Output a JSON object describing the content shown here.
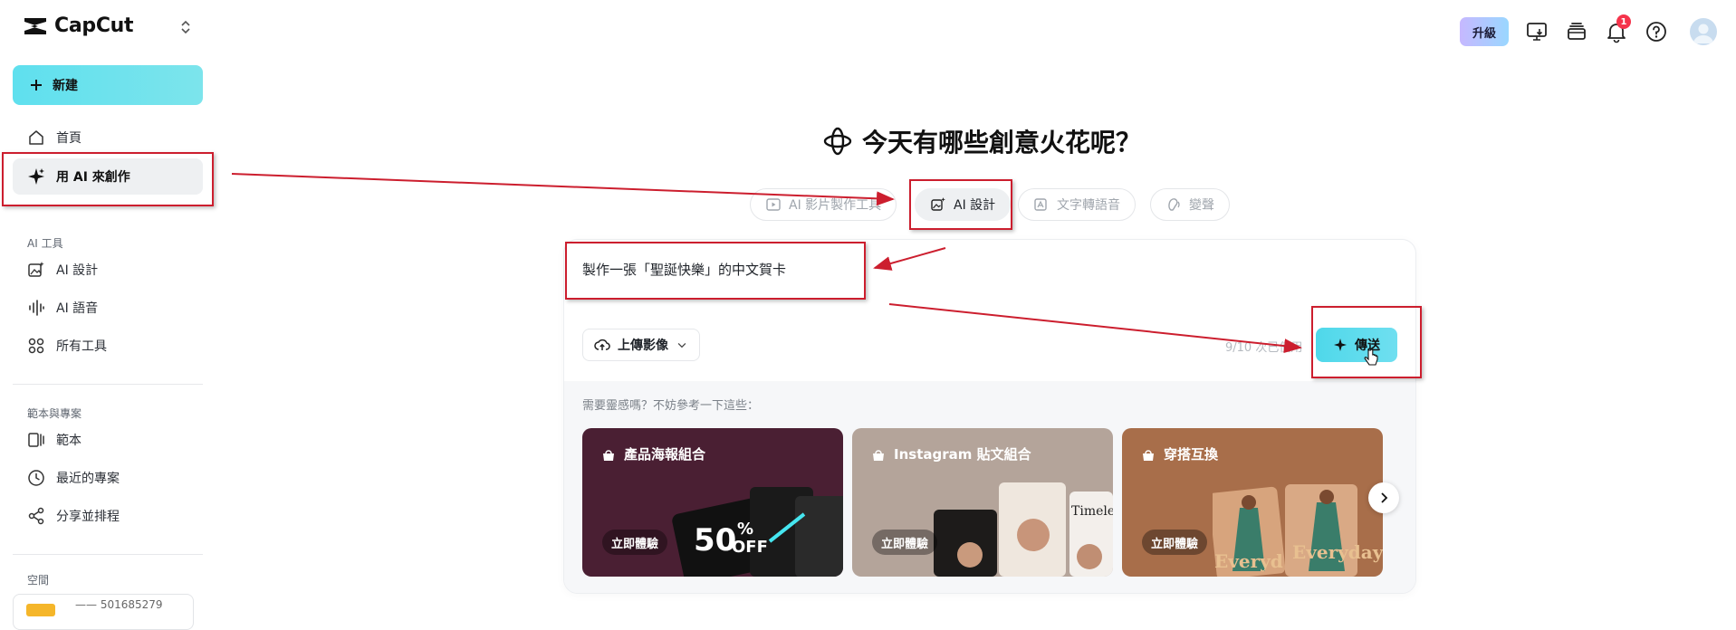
{
  "app": {
    "name": "CapCut"
  },
  "sidebar": {
    "new_label": "新建",
    "nav_top": [
      {
        "label": "首頁",
        "icon": "home-icon"
      },
      {
        "label": "用 AI 來創作",
        "icon": "sparkle-icon",
        "active": true
      }
    ],
    "ai_tools_title": "AI 工具",
    "ai_tools": [
      {
        "label": "AI 設計",
        "icon": "image-ai-icon"
      },
      {
        "label": "AI 語音",
        "icon": "waveform-icon"
      },
      {
        "label": "所有工具",
        "icon": "grid-icon"
      }
    ],
    "templates_title": "範本與專案",
    "templates": [
      {
        "label": "範本",
        "icon": "template-icon"
      },
      {
        "label": "最近的專案",
        "icon": "clock-icon"
      },
      {
        "label": "分享並排程",
        "icon": "share-icon"
      }
    ],
    "space_title": "空間",
    "space_id": "—— 501685279"
  },
  "header": {
    "upgrade_label": "升級",
    "notification_count": "1"
  },
  "main": {
    "hero_title": "今天有哪些創意火花呢？",
    "tabs": [
      {
        "label": "AI 影片製作工具",
        "icon": "video-icon"
      },
      {
        "label": "AI 設計",
        "icon": "image-ai-icon",
        "active": true
      },
      {
        "label": "文字轉語音",
        "icon": "text-speech-icon"
      },
      {
        "label": "變聲",
        "icon": "voice-change-icon"
      }
    ],
    "prompt_text": "製作一張「聖誕快樂」的中文賀卡",
    "upload_label": "上傳影像",
    "counter": "9/10 次已使用",
    "send_label": "傳送",
    "inspiration_title": "需要靈感嗎？不妨參考一下這些：",
    "cards": [
      {
        "title": "產品海報組合",
        "button": "立即體驗",
        "bg": "#4a1f33"
      },
      {
        "title": "Instagram 貼文組合",
        "button": "立即體驗",
        "bg": "#b4a49a"
      },
      {
        "title": "穿搭互換",
        "button": "立即體驗",
        "bg": "#a86e4a"
      }
    ]
  },
  "colors": {
    "accent": "#5fe0ee",
    "annotation": "#cc1e2e",
    "badge": "#f5334b"
  }
}
